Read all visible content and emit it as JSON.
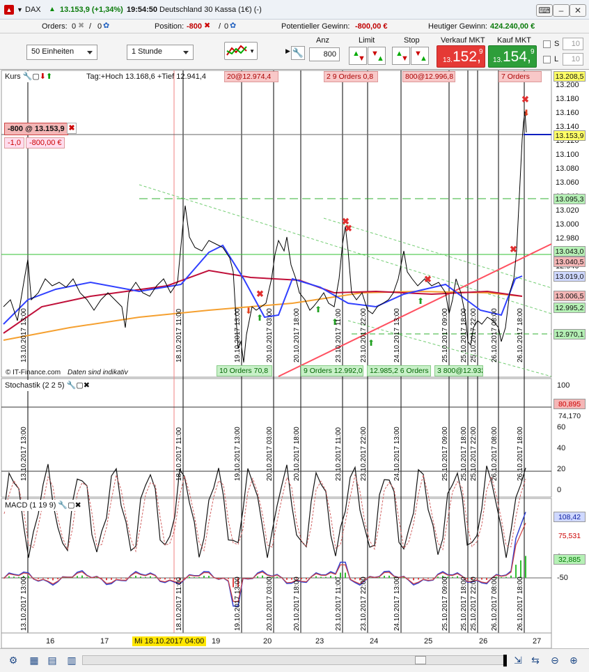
{
  "window": {
    "symbol": "DAX",
    "last": "13.153,9 (+1,34%)",
    "time": "19:54:50",
    "title": "Deutschland 30 Kassa (1€) (-)"
  },
  "info": {
    "orders_label": "Orders:",
    "orders_a": "0",
    "orders_b": "0",
    "position_label": "Position:",
    "position_val": "-800",
    "position_b": "0",
    "pot_label": "Potentieller Gewinn:",
    "pot_val": "-800,00 €",
    "heute_label": "Heutiger Gewinn:",
    "heute_val": "424.240,00 €"
  },
  "toolbar": {
    "units": "50 Einheiten",
    "interval": "1 Stunde",
    "anz_label": "Anz",
    "anz_value": "800",
    "limit_label": "Limit",
    "stop_label": "Stop",
    "sell_label": "Verkauf MKT",
    "sell_small": "13.",
    "sell_big": "152,",
    "sell_sup": "9",
    "buy_label": "Kauf MKT",
    "buy_small": "13.",
    "buy_big": "154,",
    "buy_sup": "9",
    "s_label": "S",
    "s_val": "10",
    "l_label": "L",
    "l_val": "10"
  },
  "price_panel": {
    "title": "Kurs",
    "tag_info": "Tag:+Hoch 13.168,6 +Tief 12.941,4",
    "position_tag": "-800 @ 13.153,9",
    "pl_points": "-1,0",
    "pl_money": "-800,00 €",
    "watermark_a": "© IT-Finance.com",
    "watermark_b": "Daten sind indikativ",
    "order_labels_top": [
      "20@12.974,4",
      "2 9 Orders 0,8",
      "800@12.996,8",
      "7 Orders"
    ],
    "order_labels_bottom": [
      "10 Orders 70,8",
      "9 Orders 12.992,0",
      "12.985,2 6 Orders",
      "3 800@12.932,7"
    ],
    "axis": [
      "13.200",
      "13.180",
      "13.160",
      "13.140",
      "13.120",
      "13.100",
      "13.080",
      "13.060",
      "13.040",
      "13.020",
      "13.000",
      "12.980",
      "12.960",
      "12.940"
    ],
    "tags": [
      {
        "v": "13.208,5",
        "c": "#ffff66"
      },
      {
        "v": "13.153,9",
        "c": "#ffff66"
      },
      {
        "v": "13.095,3",
        "c": "#b5f0b5"
      },
      {
        "v": "13.043,0",
        "c": "#b5f0b5"
      },
      {
        "v": "13.040,5",
        "c": "#f4b6b6"
      },
      {
        "v": "13.019,0",
        "c": "#cfd8ff"
      },
      {
        "v": "13.006,5",
        "c": "#f4b6b6"
      },
      {
        "v": "12.995,2",
        "c": "#b5f0b5"
      },
      {
        "v": "12.970,1",
        "c": "#b5f0b5"
      }
    ]
  },
  "stoch_panel": {
    "title": "Stochastik (2 2 5)",
    "axis": [
      "100",
      "80",
      "60",
      "40",
      "20",
      "0"
    ],
    "tags": [
      "80,895",
      "74,170"
    ]
  },
  "macd_panel": {
    "title": "MACD (1 19 9)",
    "axis": [
      "100",
      "50",
      "0",
      "-50"
    ],
    "tags": [
      "108,42",
      "75,531",
      "32,885"
    ]
  },
  "vlabels": [
    "13.10.2017 13:00",
    "18.10.2017 11:00",
    "19.10.2017 13:00",
    "20.10.2017 03:00",
    "20.10.2017 18:00",
    "23.10.2017 11:00",
    "23.10.2017 22:00",
    "24.10.2017 13:00",
    "25.10.2017 09:00",
    "25.10.2017 18:00",
    "25.10.2017 22:00",
    "26.10.2017 08:00",
    "26.10.2017 18:00"
  ],
  "xaxis": {
    "days": [
      "16",
      "17",
      "19",
      "20",
      "23",
      "24",
      "25",
      "26",
      "27"
    ],
    "cursor": "Mi 18.10.2017 04:00"
  }
}
